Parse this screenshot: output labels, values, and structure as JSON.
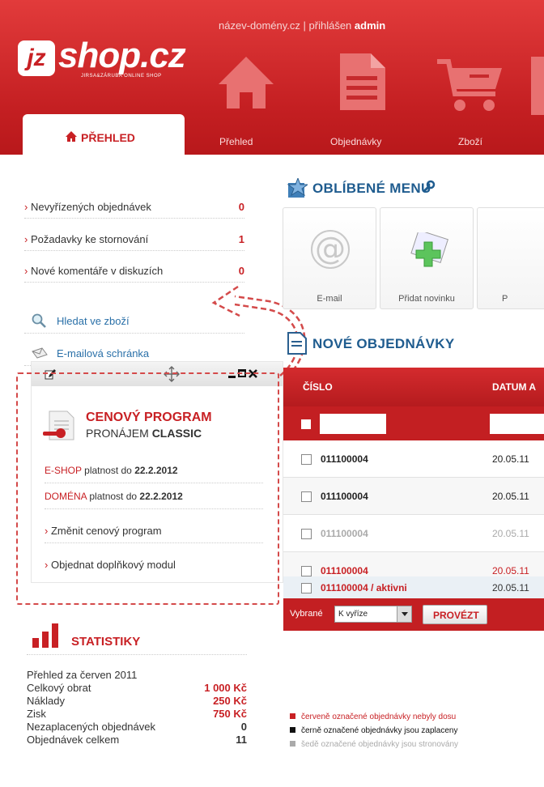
{
  "header": {
    "domain": "název-domény.cz",
    "separator": " | ",
    "logged_in": "přihlášen ",
    "user": "admin",
    "logo": {
      "jz": "jz",
      "name": "shop.cz",
      "tagline": "JIRSA&ZÁRUBA ONLINE SHOP"
    },
    "tabs": [
      {
        "label": "PŘEHLED",
        "active": true
      },
      {
        "label": "Přehled"
      },
      {
        "label": "Objednávky"
      },
      {
        "label": "Zboží"
      }
    ],
    "colors": {
      "brand": "#c82024",
      "blue": "#1f5c8f"
    }
  },
  "sidebar": {
    "counters": [
      {
        "label": "Nevyřízených objednávek",
        "count": "0"
      },
      {
        "label": "Požadavky ke stornování",
        "count": "1"
      },
      {
        "label": "Nové komentáře v diskuzích",
        "count": "0"
      }
    ],
    "links": [
      {
        "label": "Hledat ve zboží",
        "icon": "search-icon"
      },
      {
        "label": "E-mailová schránka",
        "icon": "mailbox-icon"
      }
    ]
  },
  "widget": {
    "title": "CENOVÝ PROGRAM",
    "subtitle_prefix": "PRONÁJEM ",
    "subtitle_bold": "CLASSIC",
    "eshop_label": "E-SHOP",
    "eshop_text": "platnost do ",
    "eshop_date": "22.2.2012",
    "domain_label": "DOMÉNA",
    "domain_text": "platnost do ",
    "domain_date": "22.2.2012",
    "actions": [
      "Změnit cenový program",
      "Objednat doplňkový modul"
    ]
  },
  "stats": {
    "title": "STATISTIKY",
    "period": "Přehled za červen 2011",
    "rows": [
      {
        "label": "Celkový obrat",
        "value": "1 000 Kč"
      },
      {
        "label": "Náklady",
        "value": "250 Kč"
      },
      {
        "label": "Zisk",
        "value": "750 Kč"
      },
      {
        "label": "Nezaplacených objednávek",
        "value": "0"
      },
      {
        "label": "Objednávek celkem",
        "value": "11"
      }
    ]
  },
  "favorites": {
    "title": "OBLÍBENÉ MENU",
    "items": [
      {
        "label": "E-mail",
        "icon": "at-sign-icon"
      },
      {
        "label": "Přidat novinku",
        "icon": "add-news-icon"
      },
      {
        "label": "P",
        "icon": "partial-icon"
      }
    ]
  },
  "orders": {
    "title": "NOVÉ OBJEDNÁVKY",
    "columns": [
      "ČÍSLO",
      "DATUM A"
    ],
    "rows": [
      {
        "number": "011100004",
        "date": "20.05.11",
        "status": "dark"
      },
      {
        "number": "011100004",
        "date": "20.05.11",
        "status": "dark"
      },
      {
        "number": "011100004",
        "date": "20.05.11",
        "status": "grey"
      },
      {
        "number": "011100004",
        "date": "20.05.11",
        "status": "red"
      },
      {
        "number": "011100004 / aktivni",
        "date": "20.05.11",
        "status": "red"
      }
    ],
    "footer": {
      "selected_label": "Vybrané",
      "select_value": "K vyříze",
      "button": "PROVÉZT"
    },
    "legend": [
      {
        "text": "červeně označené objednávky nebyly dosu",
        "color": "#c82024"
      },
      {
        "text": "černě označené objednávky jsou zaplaceny",
        "color": "#111111"
      },
      {
        "text": "šedě označené objednávky jsou stronovány",
        "color": "#aaaaaa"
      }
    ]
  }
}
